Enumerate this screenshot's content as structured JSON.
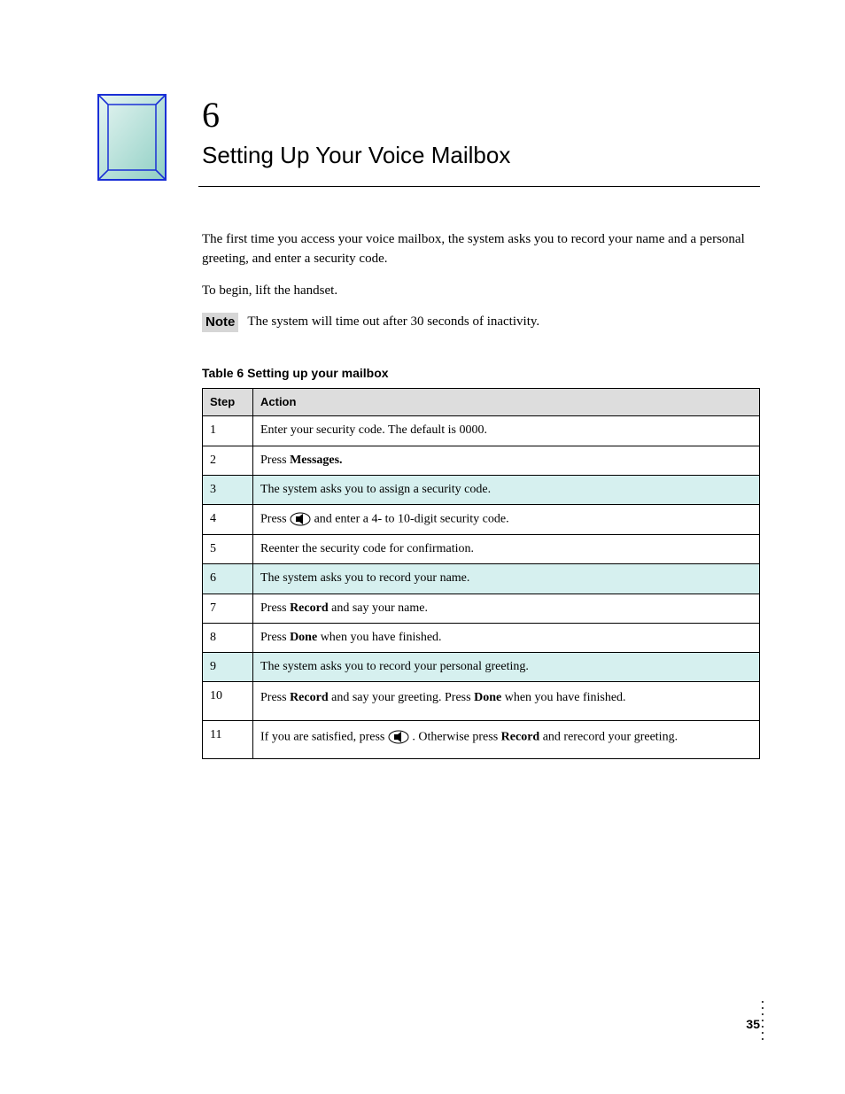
{
  "chapter": {
    "number": "6",
    "title": "Setting Up Your Voice Mailbox"
  },
  "paragraphs": {
    "p1": "The first time you access your voice mailbox, the system asks you to record your name and a personal greeting, and enter a security code.",
    "p2": "To begin, lift the handset."
  },
  "note": {
    "label": "Note",
    "text": "The system will time out after 30 seconds of inactivity."
  },
  "table": {
    "caption": "Table 6  Setting up your mailbox",
    "headers": {
      "step": "Step",
      "action": "Action"
    },
    "rows": [
      {
        "step": "1",
        "action": "Enter your security code. The default is 0000.",
        "hl": false
      },
      {
        "step": "2",
        "action_prefix": "Press ",
        "action_link": "Messages.",
        "hl": false
      },
      {
        "step": "3",
        "action": "The system asks you to assign a security code.",
        "hl": true
      },
      {
        "step": "4",
        "action_prefix": "Press ",
        "action_suffix": " and enter a 4- to 10-digit security code.",
        "hl": false,
        "icon": true
      },
      {
        "step": "5",
        "action": "Reenter the security code for confirmation.",
        "hl": false
      },
      {
        "step": "6",
        "action": "The system asks you to record your name.",
        "hl": true
      },
      {
        "step": "7",
        "action_prefix": "Press ",
        "action_link": "Record ",
        "action_suffix": "and say your name.",
        "hl": false
      },
      {
        "step": "8",
        "action_prefix": "Press ",
        "action_link": "Done ",
        "action_suffix": "when you have finished.",
        "hl": false
      },
      {
        "step": "9",
        "action": "The system asks you to record your personal greeting.",
        "hl": true
      },
      {
        "step": "10",
        "action_prefix": "Press ",
        "action_link": "Record ",
        "action_suffix": "and say your greeting. Press ",
        "action_link2": "Done ",
        "action_suffix2": "when you have finished.",
        "hl": false,
        "tall": true
      },
      {
        "step": "11",
        "action_prefix": "If you are satisfied, press ",
        "action_suffix": ". Otherwise press ",
        "action_link": "Record ",
        "action_suffix2": "and rerecord your greeting.",
        "hl": false,
        "icon": true,
        "tall": true
      }
    ]
  },
  "footer": {
    "page": "35"
  }
}
